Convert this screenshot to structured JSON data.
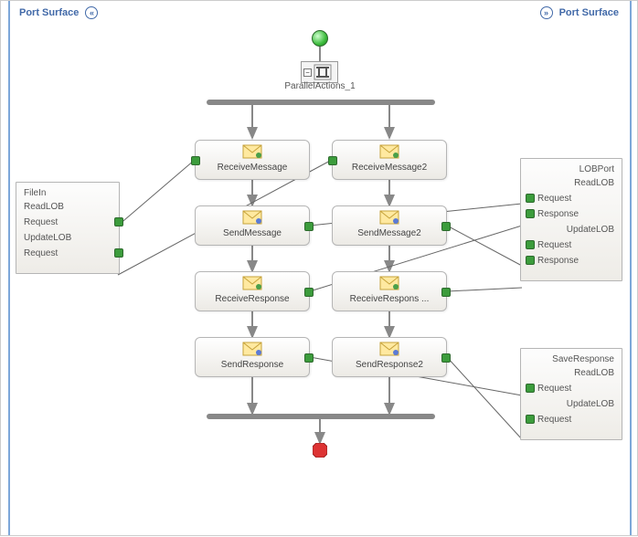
{
  "header_left": "Port Surface",
  "header_right": "Port Surface",
  "parallel": {
    "label": "ParallelActions_1"
  },
  "shapes": {
    "recv1": {
      "label": "ReceiveMessage",
      "kind": "receive"
    },
    "recv2": {
      "label": "ReceiveMessage2",
      "kind": "receive"
    },
    "send1": {
      "label": "SendMessage",
      "kind": "send"
    },
    "send2": {
      "label": "SendMessage2",
      "kind": "send"
    },
    "rresp1": {
      "label": "ReceiveResponse",
      "kind": "receive"
    },
    "rresp2": {
      "label": "ReceiveRespons ...",
      "kind": "receive"
    },
    "sresp1": {
      "label": "SendResponse",
      "kind": "send"
    },
    "sresp2": {
      "label": "SendResponse2",
      "kind": "send"
    }
  },
  "ports": {
    "filein": {
      "title": "FileIn",
      "ops": [
        {
          "name": "ReadLOB",
          "msgs": [
            "Request"
          ]
        },
        {
          "name": "UpdateLOB",
          "msgs": [
            "Request"
          ]
        }
      ]
    },
    "lobport": {
      "title": "LOBPort",
      "ops": [
        {
          "name": "ReadLOB",
          "msgs": [
            "Request",
            "Response"
          ]
        },
        {
          "name": "UpdateLOB",
          "msgs": [
            "Request",
            "Response"
          ]
        }
      ]
    },
    "save": {
      "title": "SaveResponse",
      "ops": [
        {
          "name": "ReadLOB",
          "msgs": [
            "Request"
          ]
        },
        {
          "name": "UpdateLOB",
          "msgs": [
            "Request"
          ]
        }
      ]
    }
  }
}
